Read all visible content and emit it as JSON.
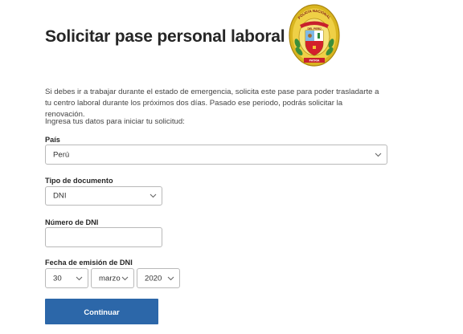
{
  "header": {
    "title": "Solicitar pase personal laboral",
    "crest": {
      "icon": "policia-nacional-crest-icon",
      "text_top": "POLICÍA NACIONAL",
      "text_mid": "DEL PERÚ",
      "text_bottom": "PATRIA",
      "colors": {
        "gold": "#e8c22c",
        "green": "#2e8b3d",
        "red": "#c8202c",
        "dark_gold": "#b08a12"
      }
    }
  },
  "intro": {
    "text": "Si debes ir a trabajar durante el estado de emergencia, solicita este pase para poder trasladarte a tu centro laboral durante los próximos dos días. Pasado ese periodo, podrás solicitar la renovación.",
    "prompt": "Ingresa tus datos para iniciar tu solicitud:"
  },
  "form": {
    "country": {
      "label": "País",
      "value": "Perú"
    },
    "document_type": {
      "label": "Tipo de documento",
      "value": "DNI"
    },
    "dni_number": {
      "label": "Número de DNI",
      "value": ""
    },
    "issue_date": {
      "label": "Fecha de emisión de DNI",
      "day": "30",
      "month": "marzo",
      "year": "2020"
    },
    "submit_label": "Continuar"
  },
  "colors": {
    "primary": "#2c67a9",
    "border": "#b9b9b9",
    "title": "#262626"
  }
}
